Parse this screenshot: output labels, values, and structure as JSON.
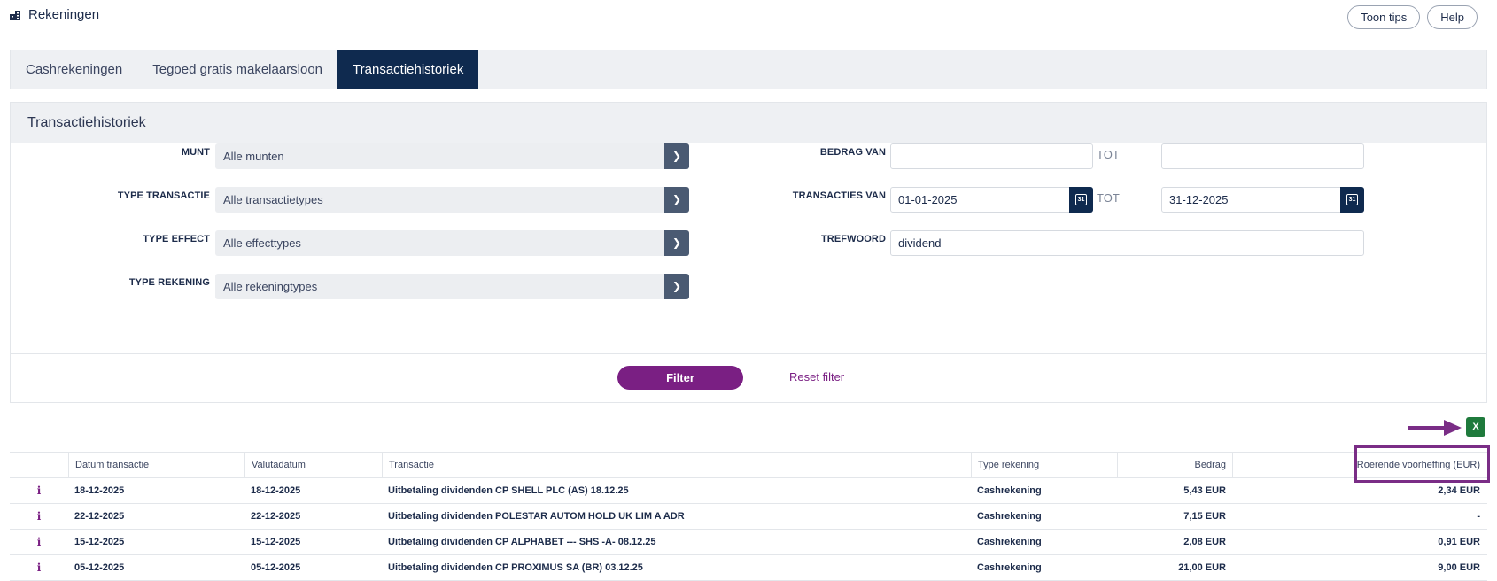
{
  "header": {
    "title": "Rekeningen",
    "icon": "accounts-icon",
    "tips_label": "Toon tips",
    "help_label": "Help"
  },
  "tabs": [
    {
      "label": "Cashrekeningen",
      "active": false
    },
    {
      "label": "Tegoed gratis makelaarsloon",
      "active": false
    },
    {
      "label": "Transactiehistoriek",
      "active": true
    }
  ],
  "panel": {
    "title": "Transactiehistoriek",
    "munt_label": "MUNT",
    "munt_value": "Alle munten",
    "type_transactie_label": "TYPE TRANSACTIE",
    "type_transactie_value": "Alle transactietypes",
    "type_effect_label": "TYPE EFFECT",
    "type_effect_value": "Alle effecttypes",
    "type_rekening_label": "TYPE REKENING",
    "type_rekening_value": "Alle rekeningtypes",
    "bedrag_van_label": "BEDRAG VAN",
    "bedrag_van_value": "",
    "bedrag_tot_label": "TOT",
    "bedrag_tot_value": "",
    "transacties_van_label": "TRANSACTIES VAN",
    "transacties_van_value": "01-01-2025",
    "transacties_tot_label": "TOT",
    "transacties_tot_value": "31-12-2025",
    "calendar_day": "31",
    "trefwoord_label": "TREFWOORD",
    "trefwoord_value": "dividend",
    "filter_label": "Filter",
    "reset_label": "Reset filter"
  },
  "export": {
    "icon": "excel-export-icon",
    "icon_text": "X"
  },
  "table": {
    "columns": [
      "",
      "Datum transactie",
      "Valutadatum",
      "Transactie",
      "Type rekening",
      "Bedrag",
      "Roerende voorheffing (EUR)"
    ],
    "rows": [
      {
        "info": "i",
        "datum": "18-12-2025",
        "valuta": "18-12-2025",
        "transactie": "Uitbetaling dividenden CP SHELL PLC (AS) 18.12.25",
        "type": "Cashrekening",
        "bedrag": "5,43 EUR",
        "roerende": "2,34 EUR"
      },
      {
        "info": "i",
        "datum": "22-12-2025",
        "valuta": "22-12-2025",
        "transactie": "Uitbetaling dividenden POLESTAR AUTOM HOLD UK LIM A ADR",
        "type": "Cashrekening",
        "bedrag": "7,15 EUR",
        "roerende": "-"
      },
      {
        "info": "i",
        "datum": "15-12-2025",
        "valuta": "15-12-2025",
        "transactie": "Uitbetaling dividenden CP ALPHABET --- SHS -A- 08.12.25",
        "type": "Cashrekening",
        "bedrag": "2,08 EUR",
        "roerende": "0,91 EUR"
      },
      {
        "info": "i",
        "datum": "05-12-2025",
        "valuta": "05-12-2025",
        "transactie": "Uitbetaling dividenden CP PROXIMUS SA (BR) 03.12.25",
        "type": "Cashrekening",
        "bedrag": "21,00 EUR",
        "roerende": "9,00 EUR"
      }
    ]
  },
  "colors": {
    "navy": "#0f2a4f",
    "purple": "#7a1f83",
    "excel_green": "#1f7a3c",
    "highlight": "#7a2d86"
  }
}
